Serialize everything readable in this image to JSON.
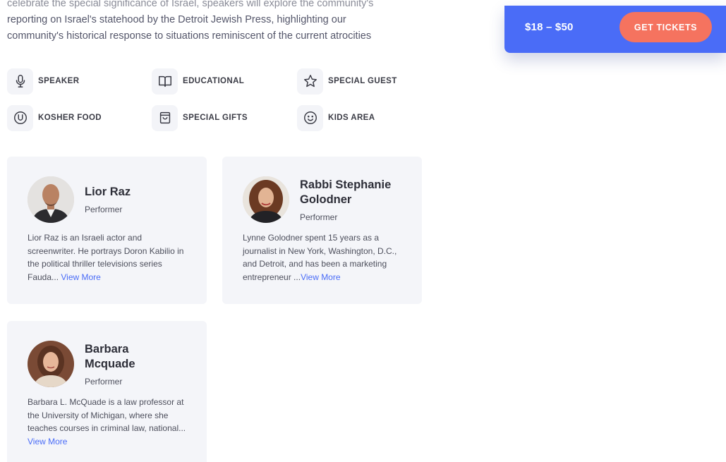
{
  "intro": {
    "line_top": "celebrate the special significance of Israel, speakers will explore the community's",
    "line_1": "reporting on Israel's statehood by the Detroit Jewish Press, highlighting our",
    "line_2": "community's historical response to situations reminiscent of the current atrocities"
  },
  "tickets": {
    "price": "$18 – $50",
    "button_label": "GET TICKETS"
  },
  "features": [
    {
      "label": "SPEAKER",
      "icon": "microphone-icon"
    },
    {
      "label": "EDUCATIONAL",
      "icon": "open-book-icon"
    },
    {
      "label": "SPECIAL GUEST",
      "icon": "star-icon"
    },
    {
      "label": "KOSHER FOOD",
      "icon": "kosher-u-icon"
    },
    {
      "label": "SPECIAL GIFTS",
      "icon": "shopping-bag-icon"
    },
    {
      "label": "KIDS AREA",
      "icon": "smiley-icon"
    }
  ],
  "speakers": [
    {
      "name": "Lior Raz",
      "role": "Performer",
      "bio": "Lior Raz is an Israeli actor and screenwriter.  He portrays Doron Kabilio in the political thriller televisions series Fauda... ",
      "view_more": "View More"
    },
    {
      "name": "Rabbi Stephanie Golodner",
      "role": "Performer",
      "bio": "Lynne Golodner spent 15 years as a journalist in New York, Washington, D.C., and Detroit, and has been a marketing entrepreneur ...",
      "view_more": "View More"
    },
    {
      "name": "Barbara Mcquade",
      "role": "Performer",
      "bio": "Barbara L. McQuade is a law professor at the University of Michigan, where she teaches courses in criminal law, national... ",
      "view_more": "View More"
    }
  ],
  "colors": {
    "accent_blue": "#4a6cf7",
    "button_coral": "#f5735f",
    "card_bg": "#f4f5f9"
  }
}
